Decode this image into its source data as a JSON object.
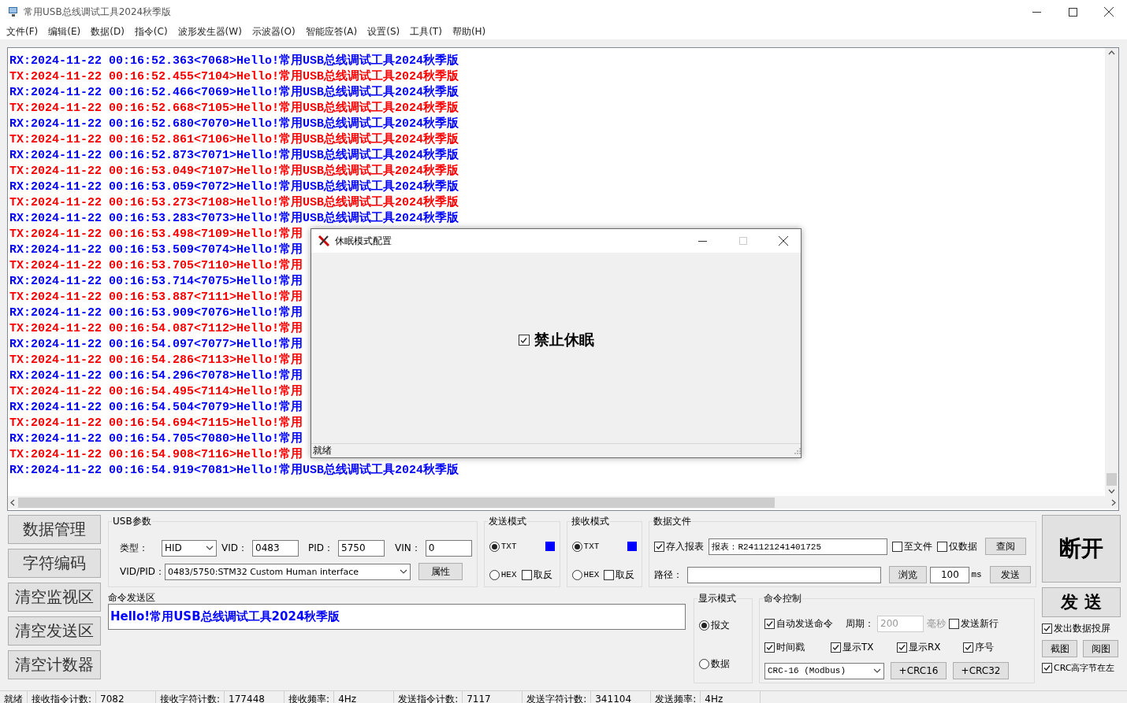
{
  "window": {
    "title": "常用USB总线调试工具2024秋季版"
  },
  "menu": [
    "文件(F)",
    "编辑(E)",
    "数据(D)",
    "指令(C)",
    "波形发生器(W)",
    "示波器(O)",
    "智能应答(A)",
    "设置(S)",
    "工具(T)",
    "帮助(H)"
  ],
  "log": {
    "lines": [
      {
        "kind": "rx",
        "text": "RX:2024-11-22 00:16:52.363<7068>Hello!常用USB总线调试工具2024秋季版"
      },
      {
        "kind": "tx",
        "text": "TX:2024-11-22 00:16:52.455<7104>Hello!常用USB总线调试工具2024秋季版"
      },
      {
        "kind": "rx",
        "text": "RX:2024-11-22 00:16:52.466<7069>Hello!常用USB总线调试工具2024秋季版"
      },
      {
        "kind": "tx",
        "text": "TX:2024-11-22 00:16:52.668<7105>Hello!常用USB总线调试工具2024秋季版"
      },
      {
        "kind": "rx",
        "text": "RX:2024-11-22 00:16:52.680<7070>Hello!常用USB总线调试工具2024秋季版"
      },
      {
        "kind": "tx",
        "text": "TX:2024-11-22 00:16:52.861<7106>Hello!常用USB总线调试工具2024秋季版"
      },
      {
        "kind": "rx",
        "text": "RX:2024-11-22 00:16:52.873<7071>Hello!常用USB总线调试工具2024秋季版"
      },
      {
        "kind": "tx",
        "text": "TX:2024-11-22 00:16:53.049<7107>Hello!常用USB总线调试工具2024秋季版"
      },
      {
        "kind": "rx",
        "text": "RX:2024-11-22 00:16:53.059<7072>Hello!常用USB总线调试工具2024秋季版"
      },
      {
        "kind": "tx",
        "text": "TX:2024-11-22 00:16:53.273<7108>Hello!常用USB总线调试工具2024秋季版"
      },
      {
        "kind": "rx",
        "text": "RX:2024-11-22 00:16:53.283<7073>Hello!常用USB总线调试工具2024秋季版"
      },
      {
        "kind": "tx",
        "text": "TX:2024-11-22 00:16:53.498<7109>Hello!常用"
      },
      {
        "kind": "rx",
        "text": "RX:2024-11-22 00:16:53.509<7074>Hello!常用"
      },
      {
        "kind": "tx",
        "text": "TX:2024-11-22 00:16:53.705<7110>Hello!常用"
      },
      {
        "kind": "rx",
        "text": "RX:2024-11-22 00:16:53.714<7075>Hello!常用"
      },
      {
        "kind": "tx",
        "text": "TX:2024-11-22 00:16:53.887<7111>Hello!常用"
      },
      {
        "kind": "rx",
        "text": "RX:2024-11-22 00:16:53.909<7076>Hello!常用"
      },
      {
        "kind": "tx",
        "text": "TX:2024-11-22 00:16:54.087<7112>Hello!常用"
      },
      {
        "kind": "rx",
        "text": "RX:2024-11-22 00:16:54.097<7077>Hello!常用"
      },
      {
        "kind": "tx",
        "text": "TX:2024-11-22 00:16:54.286<7113>Hello!常用"
      },
      {
        "kind": "rx",
        "text": "RX:2024-11-22 00:16:54.296<7078>Hello!常用"
      },
      {
        "kind": "tx",
        "text": "TX:2024-11-22 00:16:54.495<7114>Hello!常用"
      },
      {
        "kind": "rx",
        "text": "RX:2024-11-22 00:16:54.504<7079>Hello!常用"
      },
      {
        "kind": "tx",
        "text": "TX:2024-11-22 00:16:54.694<7115>Hello!常用"
      },
      {
        "kind": "rx",
        "text": "RX:2024-11-22 00:16:54.705<7080>Hello!常用"
      },
      {
        "kind": "tx",
        "text": "TX:2024-11-22 00:16:54.908<7116>Hello!常用"
      },
      {
        "kind": "rx",
        "text": "RX:2024-11-22 00:16:54.919<7081>Hello!常用USB总线调试工具2024秋季版"
      }
    ]
  },
  "side_buttons": [
    "数据管理",
    "字符编码",
    "清空监视区",
    "清空发送区",
    "清空计数器"
  ],
  "usb_params": {
    "title": "USB参数",
    "type_label": "类型：",
    "type_value": "HID",
    "vid_label": "VID：",
    "vid_value": "0483",
    "pid_label": "PID：",
    "pid_value": "5750",
    "vin_label": "VIN：",
    "vin_value": "0",
    "vidpid_label": "VID/PID：",
    "vidpid_value": "0483/5750:STM32 Custom Human interface",
    "props_button": "属性"
  },
  "send_mode": {
    "title": "发送模式",
    "options": [
      {
        "label": "TXT",
        "selected": true
      },
      {
        "label": "HEX",
        "selected": false
      }
    ],
    "invert": {
      "label": "取反",
      "checked": false
    },
    "color": "#0000ff"
  },
  "recv_mode": {
    "title": "接收模式",
    "options": [
      {
        "label": "TXT",
        "selected": true
      },
      {
        "label": "HEX",
        "selected": false
      }
    ],
    "invert": {
      "label": "取反",
      "checked": false
    },
    "color": "#0000ff"
  },
  "data_file": {
    "title": "数据文件",
    "save_report": {
      "label": "存入报表",
      "checked": true
    },
    "report_value": "报表：R241121241401725",
    "to_file": {
      "label": "至文件",
      "checked": false
    },
    "data_only": {
      "label": "仅数据",
      "checked": false
    },
    "view_button": "查阅",
    "path_label": "路径：",
    "browse_button": "浏览",
    "interval_value": "100",
    "interval_unit": "ms",
    "send_button": "发送"
  },
  "send_area": {
    "title": "命令发送区",
    "value": "Hello!常用USB总线调试工具2024秋季版"
  },
  "display_mode": {
    "title": "显示模式",
    "options": [
      {
        "label": "报文",
        "selected": true
      },
      {
        "label": "数据",
        "selected": false
      }
    ]
  },
  "command_control": {
    "title": "命令控制",
    "auto_send": {
      "label": "自动发送命令",
      "checked": true
    },
    "period_label": "周期：",
    "period_value": "200",
    "period_disabled": true,
    "period_unit": "毫秒",
    "newline": {
      "label": "发送新行",
      "checked": false
    },
    "options": [
      {
        "label": "时间戳",
        "checked": true
      },
      {
        "label": "显示TX",
        "checked": true
      },
      {
        "label": "显示RX",
        "checked": true
      },
      {
        "label": "序号",
        "checked": true
      }
    ],
    "crc_select": "CRC-16 (Modbus)",
    "crc_buttons": [
      "+CRC16",
      "+CRC32"
    ]
  },
  "right_panel": {
    "connect_button": "断开",
    "send_button": "发 送",
    "mirror": {
      "label": "发出数据投屏",
      "checked": true
    },
    "buttons": [
      "截图",
      "阅图"
    ],
    "crc_high_first": {
      "label": "CRC高字节在左",
      "checked": true
    }
  },
  "status_bar": [
    "就绪",
    "接收指令计数:",
    "7082",
    "接收字符计数:",
    "177448",
    "接收频率:",
    "4Hz",
    "发送指令计数:",
    "7117",
    "发送字符计数:",
    "341104",
    "发送频率:",
    "4Hz"
  ],
  "dialog": {
    "title": "休眠模式配置",
    "option": {
      "label": "禁止休眠",
      "checked": true
    },
    "status": "就绪"
  }
}
